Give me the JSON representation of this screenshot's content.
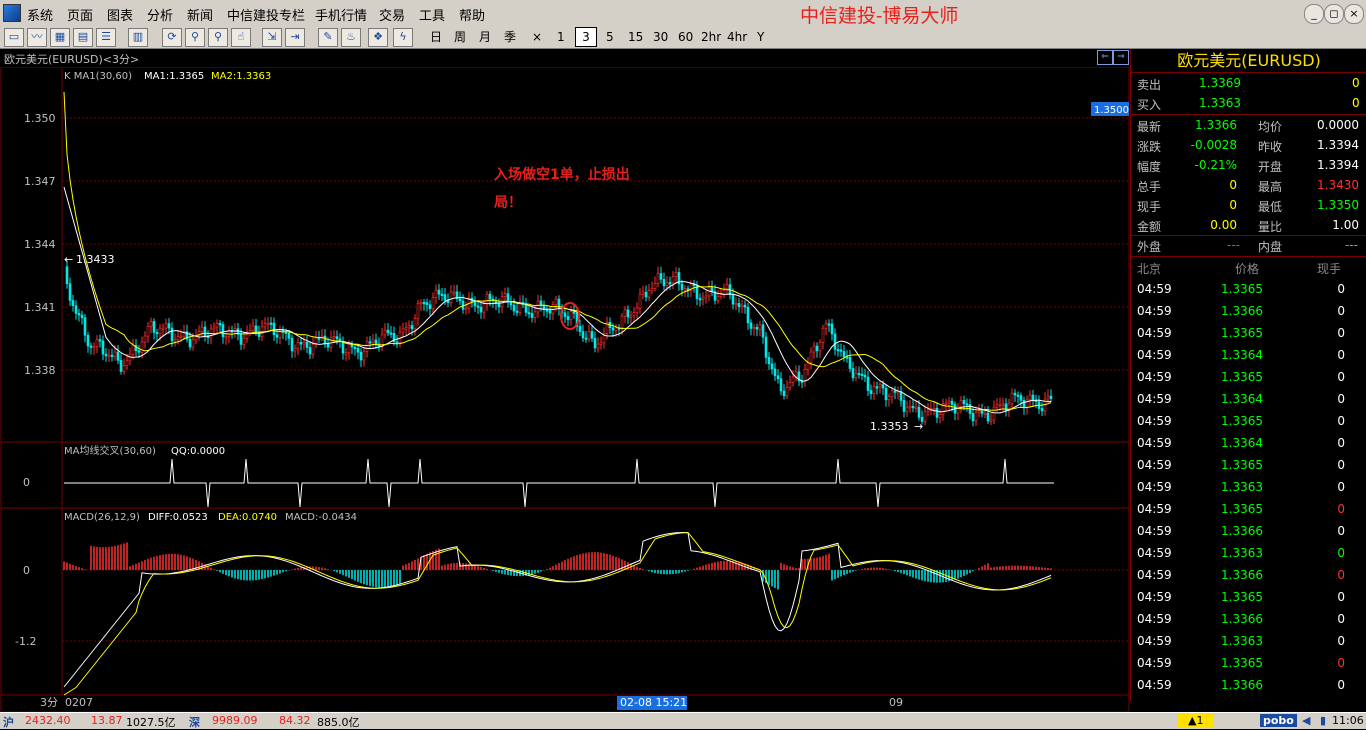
{
  "menu": {
    "items": [
      "系统",
      "页面",
      "图表",
      "分析",
      "新闻",
      "中信建投专栏",
      "手机行情",
      "交易",
      "工具",
      "帮助"
    ],
    "brand": "中信建投-博易大师",
    "window_buttons": [
      "_",
      "◻",
      "×"
    ]
  },
  "toolbar": {
    "periods": [
      "日",
      "周",
      "月",
      "季",
      "×",
      "1",
      "3",
      "5",
      "15",
      "30",
      "60",
      "2hr",
      "4hr",
      "Y"
    ],
    "active_period": "3"
  },
  "chart": {
    "window_title": "欧元美元(EURUSD)<3分>",
    "indicator_label": "K  MA1(30,60)",
    "ma1_label": "MA1:1.3365",
    "ma2_label": "MA2:1.3363",
    "price_ticks": [
      "1.350",
      "1.347",
      "1.344",
      "1.341",
      "1.338"
    ],
    "high_marker": "1.3433",
    "low_marker": "1.3353",
    "price_tag": "1.3500",
    "annotation_line1": "入场做空1单，止损出",
    "annotation_line2": "局！",
    "ma_cross_label": "MA均线交叉(30,60)",
    "qq_label": "QQ:0.0000",
    "ma_cross_tick": "0",
    "macd_label": "MACD(26,12,9)",
    "diff_label": "DIFF:0.0523",
    "dea_label": "DEA:0.0740",
    "macd_value_label": "MACD:-0.0434",
    "macd_ticks": [
      "0",
      "-1.2"
    ],
    "period_label": "3分",
    "date_start": "0207",
    "date_cursor": "02-08 15:21",
    "date_next": "09"
  },
  "quote": {
    "title": "欧元美元(EURUSD)",
    "sell_label": "卖出",
    "sell_price": "1.3369",
    "sell_vol": "0",
    "buy_label": "买入",
    "buy_price": "1.3363",
    "buy_vol": "0",
    "rows": [
      {
        "l1": "最新",
        "v1": "1.3366",
        "c1": "#00ff00",
        "l2": "均价",
        "v2": "0.0000",
        "c2": "#ffffff"
      },
      {
        "l1": "涨跌",
        "v1": "-0.0028",
        "c1": "#00ff00",
        "l2": "昨收",
        "v2": "1.3394",
        "c2": "#ffffff"
      },
      {
        "l1": "幅度",
        "v1": "-0.21%",
        "c1": "#00ff00",
        "l2": "开盘",
        "v2": "1.3394",
        "c2": "#ffffff"
      },
      {
        "l1": "总手",
        "v1": "0",
        "c1": "#ffff00",
        "l2": "最高",
        "v2": "1.3430",
        "c2": "#ff3030"
      },
      {
        "l1": "现手",
        "v1": "0",
        "c1": "#ffff00",
        "l2": "最低",
        "v2": "1.3350",
        "c2": "#00ff00"
      },
      {
        "l1": "金额",
        "v1": "0.00",
        "c1": "#ffff00",
        "l2": "量比",
        "v2": "1.00",
        "c2": "#ffffff"
      }
    ],
    "outer_label": "外盘",
    "outer_value": "---",
    "inner_label": "内盘",
    "inner_value": "---",
    "tick_headers": [
      "北京",
      "价格",
      "现手"
    ],
    "ticks": [
      {
        "time": "04:59",
        "price": "1.3365",
        "vol": "0",
        "vc": "#ffffff"
      },
      {
        "time": "04:59",
        "price": "1.3366",
        "vol": "0",
        "vc": "#ffffff"
      },
      {
        "time": "04:59",
        "price": "1.3365",
        "vol": "0",
        "vc": "#ffffff"
      },
      {
        "time": "04:59",
        "price": "1.3364",
        "vol": "0",
        "vc": "#ffffff"
      },
      {
        "time": "04:59",
        "price": "1.3365",
        "vol": "0",
        "vc": "#ffffff"
      },
      {
        "time": "04:59",
        "price": "1.3364",
        "vol": "0",
        "vc": "#ffffff"
      },
      {
        "time": "04:59",
        "price": "1.3365",
        "vol": "0",
        "vc": "#ffffff"
      },
      {
        "time": "04:59",
        "price": "1.3364",
        "vol": "0",
        "vc": "#ffffff"
      },
      {
        "time": "04:59",
        "price": "1.3365",
        "vol": "0",
        "vc": "#ffffff"
      },
      {
        "time": "04:59",
        "price": "1.3363",
        "vol": "0",
        "vc": "#ffffff"
      },
      {
        "time": "04:59",
        "price": "1.3365",
        "vol": "0",
        "vc": "#ff3030"
      },
      {
        "time": "04:59",
        "price": "1.3366",
        "vol": "0",
        "vc": "#ffffff"
      },
      {
        "time": "04:59",
        "price": "1.3363",
        "vol": "0",
        "vc": "#00ff00"
      },
      {
        "time": "04:59",
        "price": "1.3366",
        "vol": "0",
        "vc": "#ff3030"
      },
      {
        "time": "04:59",
        "price": "1.3365",
        "vol": "0",
        "vc": "#ffffff"
      },
      {
        "time": "04:59",
        "price": "1.3366",
        "vol": "0",
        "vc": "#ffffff"
      },
      {
        "time": "04:59",
        "price": "1.3363",
        "vol": "0",
        "vc": "#ffffff"
      },
      {
        "time": "04:59",
        "price": "1.3365",
        "vol": "0",
        "vc": "#ff3030"
      },
      {
        "time": "04:59",
        "price": "1.3366",
        "vol": "0",
        "vc": "#ffffff"
      }
    ]
  },
  "status": {
    "sh_label": "沪",
    "sh_index": "2432.40",
    "sh_change": "13.87",
    "sh_amount": "1027.5亿",
    "sz_label": "深",
    "sz_index": "9989.09",
    "sz_change": "84.32",
    "sz_amount": "885.0亿",
    "alert": "▲1",
    "logo": "pobo",
    "time": "11:06"
  },
  "colors": {
    "up": "#ff3030",
    "down": "#00ff00",
    "ma1": "#ffffff",
    "ma2": "#ffff00",
    "grid": "#7a0000",
    "macd_neg": "#00e8e8"
  }
}
